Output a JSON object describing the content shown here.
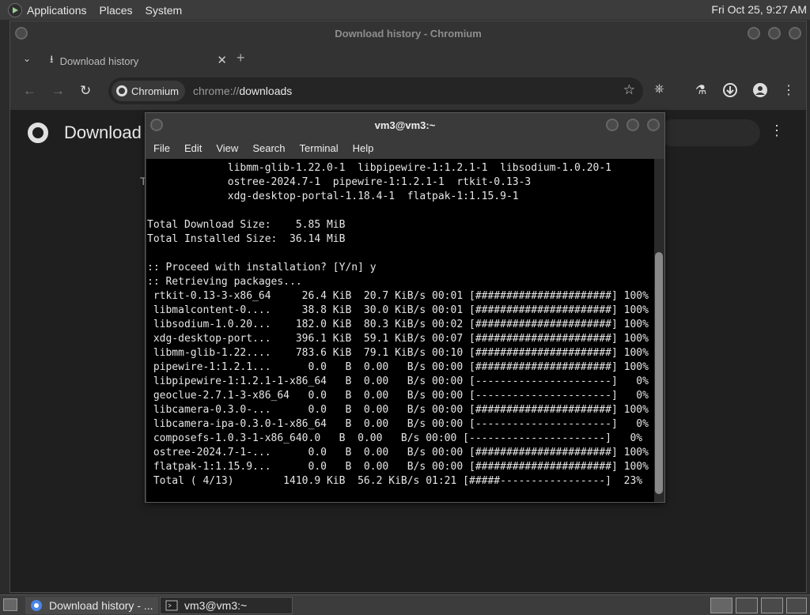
{
  "top_panel": {
    "applications": "Applications",
    "places": "Places",
    "system": "System",
    "clock": "Fri Oct 25,  9:27 AM"
  },
  "chromium": {
    "window_title": "Download history - Chromium",
    "tab_label": "Download history",
    "omnibox_chip": "Chromium",
    "url_prefix": "chrome://",
    "url_path": "downloads",
    "page_title": "Download",
    "page_partial": "T"
  },
  "terminal": {
    "title": "vm3@vm3:~",
    "menu": [
      "File",
      "Edit",
      "View",
      "Search",
      "Terminal",
      "Help"
    ],
    "lines": [
      "             libmm-glib-1.22.0-1  libpipewire-1:1.2.1-1  libsodium-1.0.20-1",
      "             ostree-2024.7-1  pipewire-1:1.2.1-1  rtkit-0.13-3",
      "             xdg-desktop-portal-1.18.4-1  flatpak-1:1.15.9-1",
      "",
      "Total Download Size:    5.85 MiB",
      "Total Installed Size:  36.14 MiB",
      "",
      ":: Proceed with installation? [Y/n] y",
      ":: Retrieving packages...",
      " rtkit-0.13-3-x86_64     26.4 KiB  20.7 KiB/s 00:01 [######################] 100%",
      " libmalcontent-0....     38.8 KiB  30.0 KiB/s 00:01 [######################] 100%",
      " libsodium-1.0.20...    182.0 KiB  80.3 KiB/s 00:02 [######################] 100%",
      " xdg-desktop-port...    396.1 KiB  59.1 KiB/s 00:07 [######################] 100%",
      " libmm-glib-1.22....    783.6 KiB  79.1 KiB/s 00:10 [######################] 100%",
      " pipewire-1:1.2.1...      0.0   B  0.00   B/s 00:00 [######################] 100%",
      " libpipewire-1:1.2.1-1-x86_64   B  0.00   B/s 00:00 [----------------------]   0%",
      " geoclue-2.7.1-3-x86_64   0.0   B  0.00   B/s 00:00 [----------------------]   0%",
      " libcamera-0.3.0-...      0.0   B  0.00   B/s 00:00 [######################] 100%",
      " libcamera-ipa-0.3.0-1-x86_64   B  0.00   B/s 00:00 [----------------------]   0%",
      " composefs-1.0.3-1-x86_640.0   B  0.00   B/s 00:00 [----------------------]   0%",
      " ostree-2024.7-1-...      0.0   B  0.00   B/s 00:00 [######################] 100%",
      " flatpak-1:1.15.9...      0.0   B  0.00   B/s 00:00 [######################] 100%",
      " Total ( 4/13)        1410.9 KiB  56.2 KiB/s 01:21 [#####-----------------]  23%"
    ]
  },
  "taskbar": {
    "task1": "Download history - ...",
    "task2": "vm3@vm3:~"
  }
}
